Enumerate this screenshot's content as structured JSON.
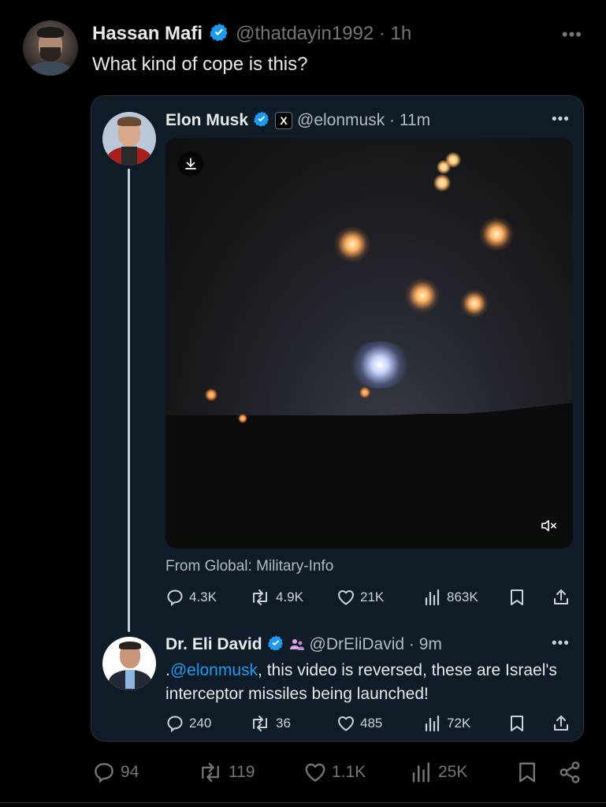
{
  "outer": {
    "name": "Hassan Mafi",
    "handle": "@thatdayin1992 · 1h",
    "text": "What kind of cope is this?",
    "more": "•••",
    "stats": {
      "replies": "94",
      "retweets": "119",
      "likes": "1.1K",
      "views": "25K"
    }
  },
  "quoted": {
    "name": "Elon Musk",
    "badge": "X",
    "handle": "@elonmusk · 11m",
    "more": "•••",
    "source": "From Global: Military-Info",
    "stats": {
      "replies": "4.3K",
      "retweets": "4.9K",
      "likes": "21K",
      "views": "863K"
    }
  },
  "reply": {
    "name": "Dr. Eli David",
    "handle": "@DrEliDavid · 9m",
    "more": "•••",
    "text_prefix": ".",
    "mention": "@elonmusk",
    "text_rest": ", this video is reversed, these are Israel's interceptor missiles being launched!",
    "stats": {
      "replies": "240",
      "retweets": "36",
      "likes": "485",
      "views": "72K"
    }
  },
  "colors": {
    "verified": "#1d9bf0",
    "background": "#000000",
    "card": "#0f1b27",
    "link": "#1d9bf0",
    "muted": "#71767b"
  }
}
